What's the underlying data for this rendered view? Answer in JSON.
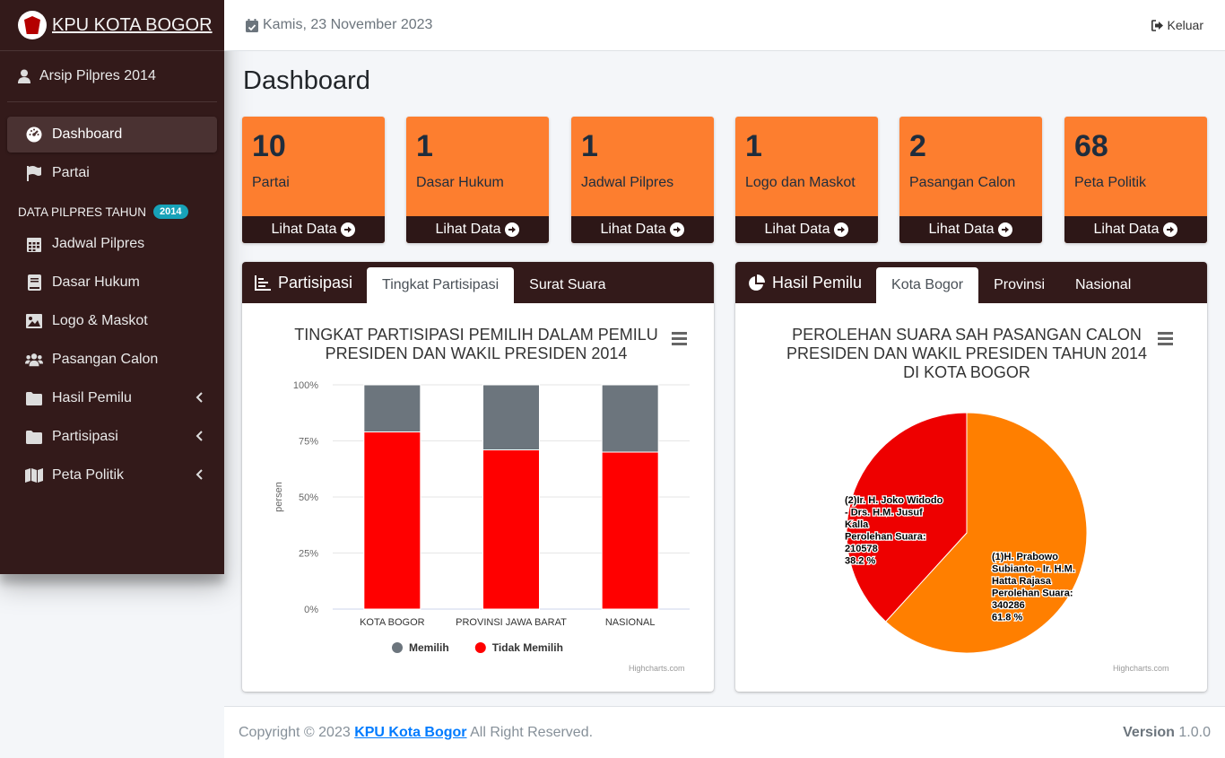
{
  "brand": {
    "name": "KPU KOTA BOGOR"
  },
  "user": {
    "name": "Arsip Pilpres 2014"
  },
  "sidebar": {
    "items": [
      {
        "label": "Dashboard",
        "icon": "dashboard-icon",
        "active": true
      },
      {
        "label": "Partai",
        "icon": "flag-icon"
      }
    ],
    "section_header": "DATA PILPRES TAHUN",
    "section_badge": "2014",
    "items2": [
      {
        "label": "Jadwal Pilpres",
        "icon": "calendar-icon"
      },
      {
        "label": "Dasar Hukum",
        "icon": "book-icon"
      },
      {
        "label": "Logo & Maskot",
        "icon": "image-icon"
      },
      {
        "label": "Pasangan Calon",
        "icon": "users-icon"
      },
      {
        "label": "Hasil Pemilu",
        "icon": "folder-icon",
        "has_children": true
      },
      {
        "label": "Partisipasi",
        "icon": "folder-icon",
        "has_children": true
      },
      {
        "label": "Peta Politik",
        "icon": "map-icon",
        "has_children": true
      }
    ]
  },
  "topbar": {
    "date": "Kamis, 23 November 2023",
    "logout": "Keluar"
  },
  "page": {
    "title": "Dashboard"
  },
  "stats": [
    {
      "value": "10",
      "label": "Partai",
      "link": "Lihat Data"
    },
    {
      "value": "1",
      "label": "Dasar Hukum",
      "link": "Lihat Data"
    },
    {
      "value": "1",
      "label": "Jadwal Pilpres",
      "link": "Lihat Data"
    },
    {
      "value": "1",
      "label": "Logo dan Maskot",
      "link": "Lihat Data"
    },
    {
      "value": "2",
      "label": "Pasangan Calon",
      "link": "Lihat Data"
    },
    {
      "value": "68",
      "label": "Peta Politik",
      "link": "Lihat Data"
    }
  ],
  "card_partisipasi": {
    "title": "Partisipasi",
    "tabs": [
      "Tingkat Partisipasi",
      "Surat Suara"
    ],
    "active_tab": 0
  },
  "card_hasil": {
    "title": "Hasil Pemilu",
    "tabs": [
      "Kota Bogor",
      "Provinsi",
      "Nasional"
    ],
    "active_tab": 0
  },
  "colors": {
    "sidebar": "#331a1a",
    "box": "#fd7e2f",
    "memilih": "#6c757d",
    "tidak_memilih": "#ff0000",
    "pie_1": "#ff7f00",
    "pie_2": "#ee0000"
  },
  "chart_data": [
    {
      "type": "bar",
      "stacked": true,
      "title_lines": [
        "TINGKAT PARTISIPASI PEMILIH DALAM PEMILU",
        "PRESIDEN DAN WAKIL PRESIDEN 2014"
      ],
      "ylabel": "persen",
      "ylim": [
        0,
        100
      ],
      "yticks": [
        "0%",
        "25%",
        "50%",
        "75%",
        "100%"
      ],
      "categories": [
        "KOTA BOGOR",
        "PROVINSI JAWA BARAT",
        "NASIONAL"
      ],
      "series": [
        {
          "name": "Memilih",
          "values": [
            21,
            29,
            30
          ]
        },
        {
          "name": "Tidak Memilih",
          "values": [
            79,
            71,
            70
          ]
        }
      ],
      "legend": "bottom-center",
      "credit": "Highcharts.com"
    },
    {
      "type": "pie",
      "title_lines": [
        "PEROLEHAN SUARA SAH PASANGAN CALON",
        "PRESIDEN DAN WAKIL PRESIDEN TAHUN 2014",
        "DI KOTA BOGOR"
      ],
      "slices": [
        {
          "label_lines": [
            "(1)H. Prabowo",
            "Subianto - Ir. H.M.",
            "Hatta Rajasa",
            "Perolehan Suara:",
            "340286",
            "61.8 %"
          ],
          "value": 340286,
          "percent": 61.8
        },
        {
          "label_lines": [
            "(2)Ir. H. Joko Widodo",
            "- Drs. H.M. Jusuf",
            "Kalla",
            "Perolehan Suara:",
            "210578",
            "38.2 %"
          ],
          "value": 210578,
          "percent": 38.2
        }
      ],
      "credit": "Highcharts.com"
    }
  ],
  "footer": {
    "copyright_prefix": "Copyright © 2023",
    "link": "KPU Kota Bogor",
    "suffix": "All Right Reserved.",
    "version_label": "Version",
    "version": "1.0.0"
  }
}
